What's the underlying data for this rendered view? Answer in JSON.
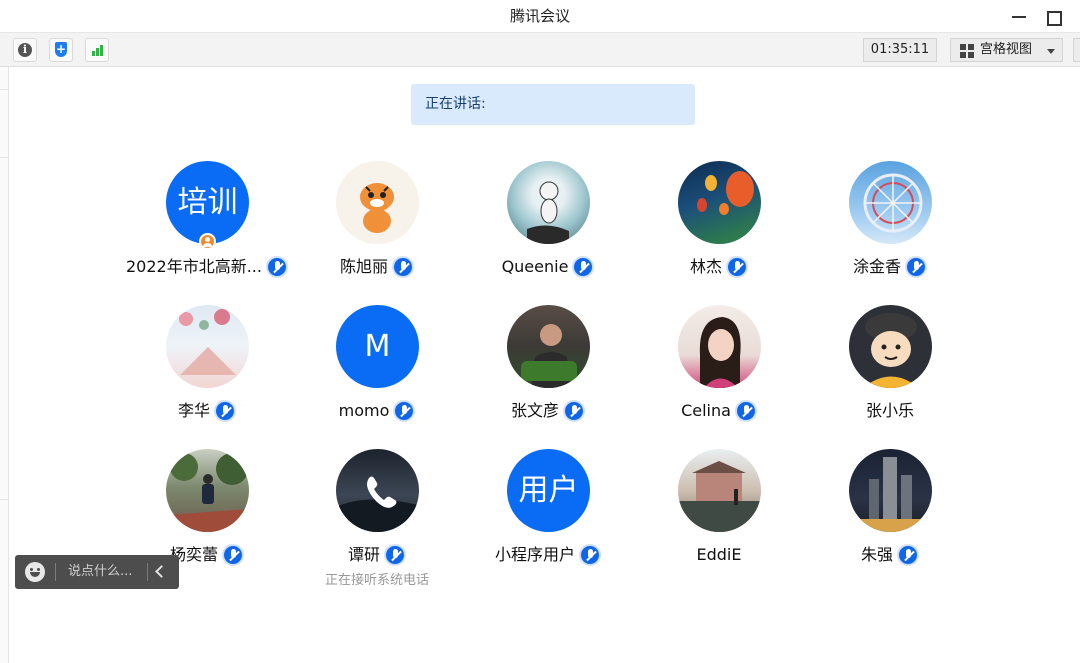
{
  "window": {
    "title": "腾讯会议"
  },
  "toolbar": {
    "timer": "01:35:11",
    "view_label": "宫格视图"
  },
  "speaking_label": "正在讲话:",
  "participants": [
    {
      "name": "2022年市北高新...",
      "avatar_text": "培训",
      "mic": true,
      "host": true
    },
    {
      "name": "陈旭丽",
      "mic": true
    },
    {
      "name": "Queenie",
      "mic": true
    },
    {
      "name": "林杰",
      "mic": true
    },
    {
      "name": "涂金香",
      "mic": true
    },
    {
      "name": "李华",
      "mic": true
    },
    {
      "name": "momo",
      "avatar_text": "M",
      "mic": true
    },
    {
      "name": "张文彦",
      "mic": true
    },
    {
      "name": "Celina",
      "mic": true
    },
    {
      "name": "张小乐",
      "mic": false
    },
    {
      "name": "杨奕蕾",
      "mic": true
    },
    {
      "name": "谭研",
      "mic": true,
      "status": "正在接听系统电话"
    },
    {
      "name": "小程序用户",
      "avatar_text": "用户",
      "mic": true
    },
    {
      "name": "EddiE",
      "mic": false
    },
    {
      "name": "朱强",
      "mic": true
    }
  ],
  "chat": {
    "placeholder": "说点什么..."
  },
  "colors": {
    "accent": "#0a6cf5",
    "speaking_bg": "#d9eafd",
    "host_badge": "#f08a2d"
  }
}
